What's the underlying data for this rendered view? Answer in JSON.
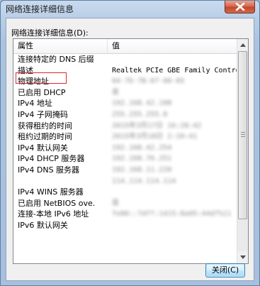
{
  "window": {
    "title": "网络连接详细信息"
  },
  "list_label": "网络连接详细信息(D):",
  "columns": {
    "property": "属性",
    "value": "值"
  },
  "rows": [
    {
      "property": "连接特定的 DNS 后缀",
      "value": "",
      "blurred": false
    },
    {
      "property": "描述",
      "value": "Realtek PCIe GBE Family Controller",
      "blurred": false
    },
    {
      "property": "物理地址",
      "value": "04-7D-7B-07-00-05",
      "blurred": true
    },
    {
      "property": "已启用 DHCP",
      "value": "是",
      "blurred": true
    },
    {
      "property": "IPv4 地址",
      "value": "192.168.42.108",
      "blurred": true
    },
    {
      "property": "IPv4 子网掩码",
      "value": "255.255.255.0",
      "blurred": true
    },
    {
      "property": "获得租约的时间",
      "value": "2015年3月17日 16:28:42",
      "blurred": true
    },
    {
      "property": "租约过期的时间",
      "value": "2015年3月18日 2:10:41",
      "blurred": true
    },
    {
      "property": "IPv4 默认网关",
      "value": "192.168.42.254",
      "blurred": true
    },
    {
      "property": "IPv4 DHCP 服务器",
      "value": "192.168.76.251",
      "blurred": true
    },
    {
      "property": "IPv4 DNS 服务器",
      "value": "192.168.11.220",
      "blurred": true
    },
    {
      "property": "",
      "value": "114.114.114.114",
      "blurred": true
    },
    {
      "property": "IPv4 WINS 服务器",
      "value": "",
      "blurred": false
    },
    {
      "property": "已启用 NetBIOS ove.",
      "value": "是",
      "blurred": true
    },
    {
      "property": "连接-本地 IPv6 地址",
      "value": "fe80::7dff:1415:8a95:44d7%11",
      "blurred": true
    },
    {
      "property": "IPv6 默认网关",
      "value": "",
      "blurred": false
    }
  ],
  "buttons": {
    "close": "关闭(C)"
  },
  "colors": {
    "highlight_box": "#e0262b",
    "close_button_border": "#3c7fb1",
    "title_close_red": "#c2462c"
  },
  "icons": {
    "title_close": "close-x-icon",
    "scroll_up": "arrow-up-icon",
    "scroll_down": "arrow-down-icon"
  }
}
